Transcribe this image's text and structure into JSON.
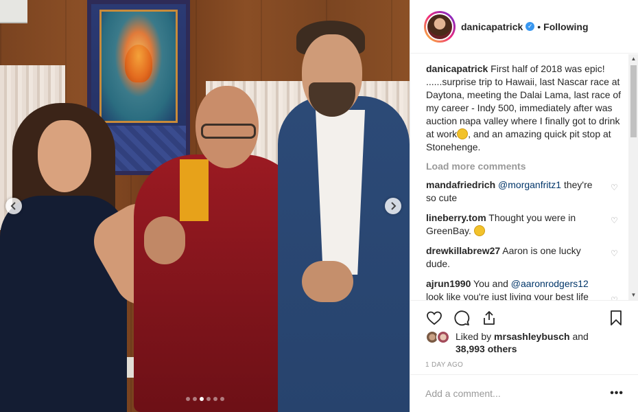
{
  "post": {
    "username": "danicapatrick",
    "verified": true,
    "separator": "•",
    "follow_status": "Following",
    "caption": {
      "username": "danicapatrick",
      "text_before_emoji": "First half of 2018 was epic! ......surprise trip to Hawaii, last Nascar race at Daytona, meeting the Dalai Lama, last race of my career - Indy 500, immediately after was auction napa valley where I finally got to drink at work",
      "text_after_emoji": ", and an amazing quick pit stop at Stonehenge."
    },
    "load_more_label": "Load more comments",
    "comments": [
      {
        "username": "mandafriedrich",
        "mention": "@morganfritz1",
        "text": " they're so cute"
      },
      {
        "username": "lineberry.tom",
        "mention": "",
        "text": "Thought you were in GreenBay. "
      },
      {
        "username": "drewkillabrew27",
        "mention": "",
        "text": "Aaron is one lucky dude."
      },
      {
        "username": "ajrun1990",
        "mention": "@aaronrodgers12",
        "text_before": "You and ",
        "text": " look like you're just living your best life together. Thank you for sharing such fun photos. We love you two and love"
      }
    ],
    "likes": {
      "prefix": "Liked by",
      "user": "mrsashleybusch",
      "joiner": "and",
      "others": "38,993 others"
    },
    "timestamp": "1 DAY AGO",
    "add_comment_placeholder": "Add a comment...",
    "more_label": "•••"
  },
  "carousel": {
    "slides": 6,
    "active_index": 2
  },
  "icons": {
    "header": [
      "verified-badge-icon"
    ],
    "actions": [
      "heart-icon",
      "comment-icon",
      "share-icon",
      "bookmark-icon"
    ],
    "nav": [
      "chevron-left-icon",
      "chevron-right-icon"
    ]
  },
  "colors": {
    "verified": "#3897f0",
    "mention": "#003569",
    "muted": "#999999",
    "text": "#262626"
  }
}
